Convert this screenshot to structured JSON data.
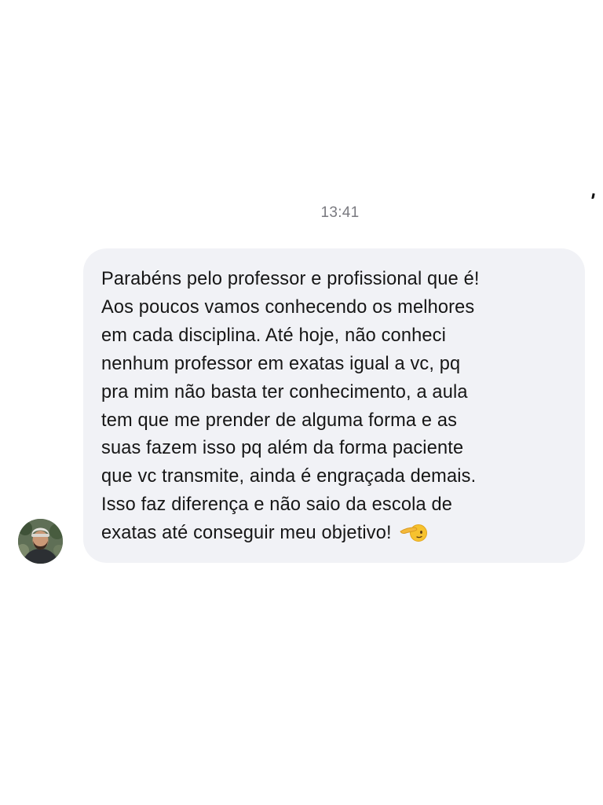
{
  "thread": {
    "timestamp": "13:41"
  },
  "message": {
    "lines": [
      "Parabéns pelo professor e profissional que é!",
      "Aos poucos vamos conhecendo os melhores",
      "em cada disciplina. Até hoje, não conheci",
      "nenhum professor em exatas igual a vc, pq",
      "pra mim não basta ter conhecimento, a aula",
      "tem que me prender de alguma forma e as",
      "suas fazem isso pq além da forma paciente",
      "que vc transmite, ainda é engraçada demais.",
      "Isso faz diferença e não saio da escola de",
      "exatas até conseguir meu objetivo!"
    ],
    "emoji_icon": "saluting-face-emoji",
    "bubble_color": "#f1f2f6",
    "text_color": "#161616"
  },
  "sender": {
    "avatar_icon": "profile-photo"
  }
}
